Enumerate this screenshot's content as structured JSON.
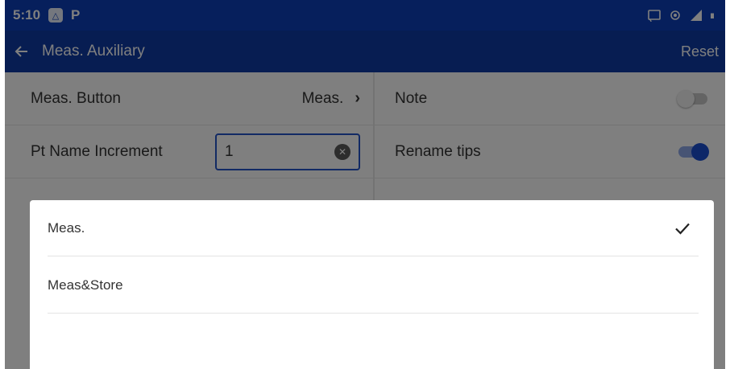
{
  "status_bar": {
    "time": "5:10",
    "icons": [
      "photos-icon",
      "parking-app-icon",
      "cast-icon",
      "hotspot-icon",
      "signal-icon",
      "battery-icon"
    ],
    "color": "#0d3fb8"
  },
  "app_bar": {
    "title": "Meas. Auxiliary",
    "reset_label": "Reset",
    "back_icon": "back-arrow-icon",
    "color": "#0e3aa5"
  },
  "settings": {
    "left": [
      {
        "label": "Meas. Button",
        "value": "Meas."
      },
      {
        "label": "Pt Name Increment",
        "value": "1"
      }
    ],
    "right": [
      {
        "label": "Note",
        "toggle": false
      },
      {
        "label": "Rename tips",
        "toggle": true
      }
    ]
  },
  "dialog": {
    "options": [
      {
        "label": "Meas.",
        "selected": true
      },
      {
        "label": "Meas&Store",
        "selected": false
      }
    ]
  },
  "colors": {
    "accent": "#1a4fd1",
    "scrim": "rgba(0,0,0,0.5)"
  }
}
